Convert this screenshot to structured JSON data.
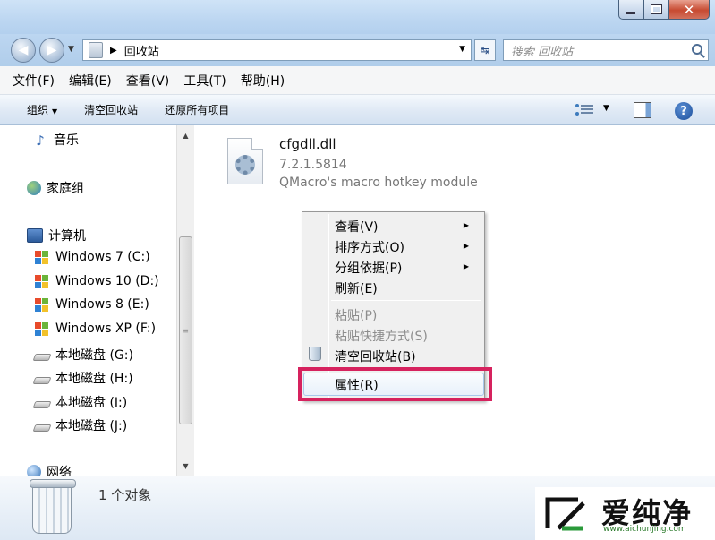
{
  "window": {
    "title": "回收站",
    "minimize_label": "",
    "maximize_label": "",
    "close_label": "✕"
  },
  "address": {
    "back_label": "◀",
    "forward_label": "▶",
    "path": "回收站",
    "refresh_label": "↹",
    "search_placeholder": "搜索 回收站"
  },
  "menubar": {
    "items": [
      "文件(F)",
      "编辑(E)",
      "查看(V)",
      "工具(T)",
      "帮助(H)"
    ]
  },
  "toolbar": {
    "organize_label": "组织",
    "empty_bin_label": "清空回收站",
    "restore_all_label": "还原所有项目",
    "help_label": "?"
  },
  "nav": {
    "items": [
      {
        "label": "音乐",
        "icon": "music-icon"
      },
      {
        "label": "家庭组",
        "icon": "homegroup-icon"
      },
      {
        "label": "计算机",
        "icon": "computer-icon"
      },
      {
        "label": "Windows 7 (C:)",
        "icon": "windows-drive-icon"
      },
      {
        "label": "Windows 10 (D:)",
        "icon": "windows-drive-icon"
      },
      {
        "label": "Windows 8 (E:)",
        "icon": "windows-drive-icon"
      },
      {
        "label": "Windows XP (F:)",
        "icon": "windows-drive-icon"
      },
      {
        "label": "本地磁盘 (G:)",
        "icon": "disk-icon"
      },
      {
        "label": "本地磁盘 (H:)",
        "icon": "disk-icon"
      },
      {
        "label": "本地磁盘 (I:)",
        "icon": "disk-icon"
      },
      {
        "label": "本地磁盘 (J:)",
        "icon": "disk-icon"
      },
      {
        "label": "网络",
        "icon": "network-icon"
      }
    ]
  },
  "file": {
    "name": "cfgdll.dll",
    "version": "7.2.1.5814",
    "description": "QMacro's macro hotkey module"
  },
  "context_menu": {
    "items": [
      {
        "label": "查看(V)",
        "submenu": true,
        "enabled": true
      },
      {
        "label": "排序方式(O)",
        "submenu": true,
        "enabled": true
      },
      {
        "label": "分组依据(P)",
        "submenu": true,
        "enabled": true
      },
      {
        "label": "刷新(E)",
        "submenu": false,
        "enabled": true
      },
      {
        "label": "粘贴(P)",
        "submenu": false,
        "enabled": false
      },
      {
        "label": "粘贴快捷方式(S)",
        "submenu": false,
        "enabled": false
      },
      {
        "label": "清空回收站(B)",
        "submenu": false,
        "enabled": true
      },
      {
        "label": "属性(R)",
        "submenu": false,
        "enabled": true,
        "highlighted": true
      }
    ],
    "highlight_color": "#d6225e"
  },
  "status": {
    "text": "1 个对象"
  },
  "watermark": {
    "text": "爱纯净",
    "url": "www.aichunjing.com"
  }
}
